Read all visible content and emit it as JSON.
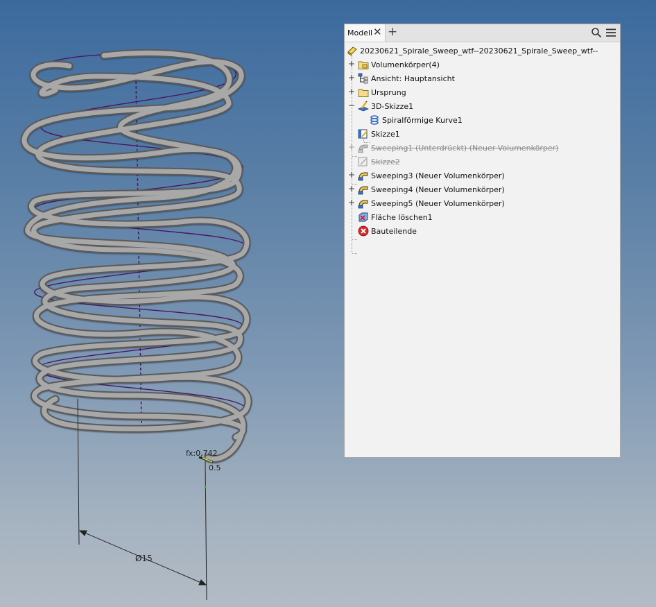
{
  "panel": {
    "tab_label": "Modell",
    "close_glyph": "✕",
    "add_glyph": "+"
  },
  "tree": {
    "root": "20230621_Spirale_Sweep_wtf--20230621_Spirale_Sweep_wtf--",
    "items": [
      {
        "label": "Volumenkörper(4)",
        "icon": "solid-bodies-folder-icon"
      },
      {
        "label": "Ansicht: Hauptansicht",
        "icon": "view-rep-icon"
      },
      {
        "label": "Ursprung",
        "icon": "origin-folder-icon"
      },
      {
        "label": "3D-Skizze1",
        "icon": "3d-sketch-icon"
      },
      {
        "label": "Spiralförmige Kurve1",
        "icon": "helical-curve-icon"
      },
      {
        "label": "Skizze1",
        "icon": "sketch-icon"
      },
      {
        "label": "Sweeping1 (Unterdrückt) (Neuer Volumenkörper)",
        "icon": "sweep-suppressed-icon"
      },
      {
        "label": "Skizze2",
        "icon": "sketch-suppressed-icon"
      },
      {
        "label": "Sweeping3 (Neuer Volumenkörper)",
        "icon": "sweep-icon"
      },
      {
        "label": "Sweeping4 (Neuer Volumenkörper)",
        "icon": "sweep-icon"
      },
      {
        "label": "Sweeping5 (Neuer Volumenkörper)",
        "icon": "sweep-icon"
      },
      {
        "label": "Fläche löschen1",
        "icon": "delete-face-icon"
      },
      {
        "label": "Bauteilende",
        "icon": "end-of-part-icon"
      }
    ]
  },
  "viewport": {
    "dim_diameter": "Ø15",
    "dim_fx": "fx:0,742",
    "dim_small": "0.5"
  },
  "colors": {
    "pipe": "#8d8d8d",
    "helix": "#4a1660",
    "background_top": "#3c6a9e",
    "background_bottom": "#b3bcc5"
  }
}
